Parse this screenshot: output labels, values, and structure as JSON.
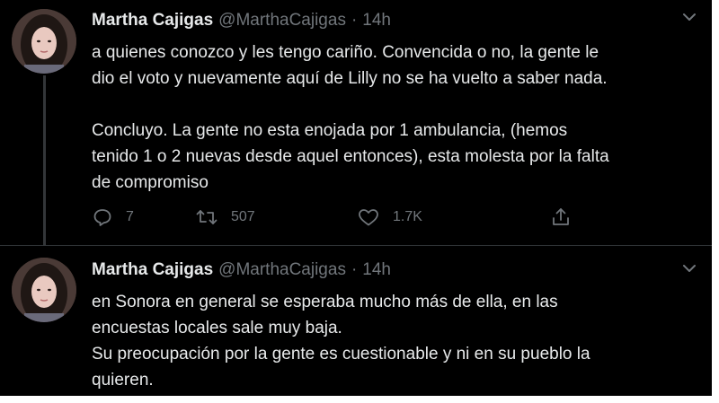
{
  "tweets": [
    {
      "author_name": "Martha Cajigas",
      "handle": "@MarthaCajigas",
      "separator": "·",
      "time": "14h",
      "lines": [
        "a quienes conozco y les tengo cariño. Convencida o no, la gente le",
        "dio el voto y nuevamente aquí de Lilly no se ha vuelto a saber nada.",
        "",
        "Concluyo. La gente no esta enojada por 1 ambulancia, (hemos",
        "tenido 1 o 2 nuevas desde aquel entonces), esta molesta por la falta",
        "de compromiso"
      ],
      "replies": "7",
      "retweets": "507",
      "likes": "1.7K"
    },
    {
      "author_name": "Martha Cajigas",
      "handle": "@MarthaCajigas",
      "separator": "·",
      "time": "14h",
      "lines": [
        "en Sonora en general se esperaba mucho más de ella, en las",
        "encuestas locales sale muy baja.",
        "Su preocupación por la gente es cuestionable y ni en su pueblo la",
        "quieren."
      ]
    }
  ],
  "icons": {
    "reply": "reply-icon",
    "retweet": "retweet-icon",
    "like": "heart-icon",
    "share": "share-icon",
    "caret": "chevron-down-icon"
  }
}
